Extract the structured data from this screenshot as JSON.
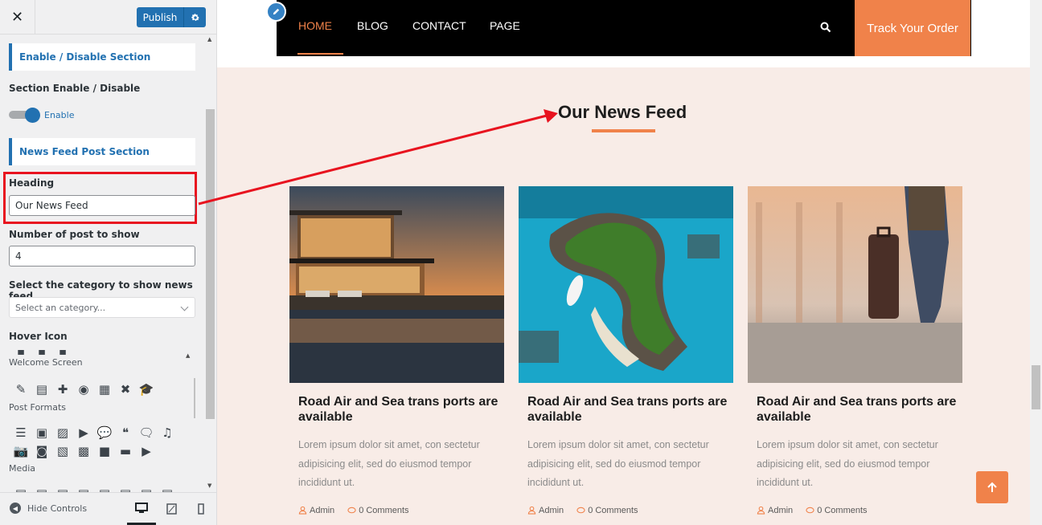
{
  "topbar": {
    "close_label": "✕",
    "publish_label": "Publish"
  },
  "panel": {
    "enable_section_title": "Enable / Disable Section",
    "section_enable_label": "Section Enable / Disable",
    "toggle_label": "Enable",
    "toggle_state": "on",
    "news_feed_section_title": "News Feed Post Section",
    "heading_label": "Heading",
    "heading_value": "Our News Feed",
    "post_count_label": "Number of post to show",
    "post_count_value": "4",
    "category_label": "Select the category to show news feed",
    "category_placeholder": "Select an category...",
    "hover_icon_label": "Hover Icon",
    "icon_categories": [
      "Welcome Screen",
      "Post Formats",
      "Media"
    ]
  },
  "footer": {
    "hide_controls_label": "Hide Controls",
    "active_device": "desktop"
  },
  "nav": {
    "items": [
      "HOME",
      "BLOG",
      "CONTACT",
      "PAGE"
    ],
    "active_item": "HOME",
    "track_order_label": "Track Your Order"
  },
  "news": {
    "heading": "Our News Feed",
    "cards": [
      {
        "image": "modern-villa-pool-sunset",
        "title": "Road Air and Sea trans ports are available",
        "excerpt": "Lorem ipsum dolor sit amet, con sectetur adipisicing elit, sed do eiusmod tempor incididunt ut.",
        "author": "Admin",
        "comments": "0 Comments"
      },
      {
        "image": "tropical-island-aerial-boat",
        "title": "Road Air and Sea trans ports are available",
        "excerpt": "Lorem ipsum dolor sit amet, con sectetur adipisicing elit, sed do eiusmod tempor incididunt ut.",
        "author": "Admin",
        "comments": "0 Comments"
      },
      {
        "image": "traveler-suitcase-airport",
        "title": "Road Air and Sea trans ports are available",
        "excerpt": "Lorem ipsum dolor sit amet, con sectetur adipisicing elit, sed do eiusmod tempor incididunt ut.",
        "author": "Admin",
        "comments": "0 Comments"
      }
    ]
  },
  "colors": {
    "wp_blue": "#2271b1",
    "accent_orange": "#f0824a",
    "annotation_red": "#e8131f",
    "nav_black": "#000000",
    "section_bg": "#f8ece7"
  }
}
